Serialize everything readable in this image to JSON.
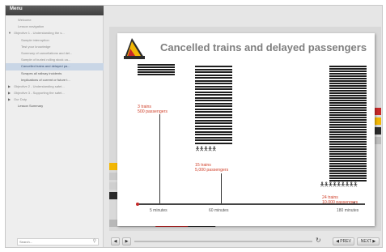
{
  "sidebar": {
    "tab_label": "Menu",
    "items": [
      {
        "label": "Welcome",
        "level": 1,
        "state": "normal"
      },
      {
        "label": "Lesson navigation",
        "level": 1,
        "state": "normal"
      },
      {
        "label": "Objective 1 - Understanding the s...",
        "level": 0,
        "state": "expanded"
      },
      {
        "label": "Sample interruption",
        "level": 2,
        "state": "normal"
      },
      {
        "label": "Test your knowledge",
        "level": 2,
        "state": "normal"
      },
      {
        "label": "Summary of cancellations and del...",
        "level": 2,
        "state": "normal"
      },
      {
        "label": "Sample of buried rolling stock ca...",
        "level": 2,
        "state": "normal"
      },
      {
        "label": "Cancelled trains and delayed pa...",
        "level": 2,
        "state": "active"
      },
      {
        "label": "Scrapes all railway incidents",
        "level": 2,
        "state": "dark"
      },
      {
        "label": "Implications of current or future t...",
        "level": 2,
        "state": "dark"
      },
      {
        "label": "Objective 2 - Understanding safet...",
        "level": 0,
        "state": "collapsed"
      },
      {
        "label": "Objective 3 - Supporting the safet...",
        "level": 0,
        "state": "collapsed"
      },
      {
        "label": "Our Duty",
        "level": 0,
        "state": "collapsed"
      },
      {
        "label": "Lesson Summary",
        "level": 1,
        "state": "dark"
      }
    ],
    "search_placeholder": "Search..."
  },
  "slide": {
    "title": "Cancelled trains and delayed passengers",
    "groups": [
      {
        "trains": "3 trains",
        "passengers": "500 passengers"
      },
      {
        "trains": "15 trains",
        "passengers": "5,000 passengers"
      },
      {
        "trains": "24 trains",
        "passengers": "10,000 passengers"
      }
    ],
    "axis_labels": [
      "5 minutes",
      "60 minutes",
      "180 minutes"
    ]
  },
  "controls": {
    "rewind_icon": "◀",
    "play_icon": "▶",
    "refresh_icon": "↻",
    "prev_label": "◀ PREV",
    "next_label": "NEXT ▶"
  },
  "colors": {
    "accent": "#d0402a",
    "active_menu": "#c9d6e6",
    "stack": "#1e1e1e"
  }
}
